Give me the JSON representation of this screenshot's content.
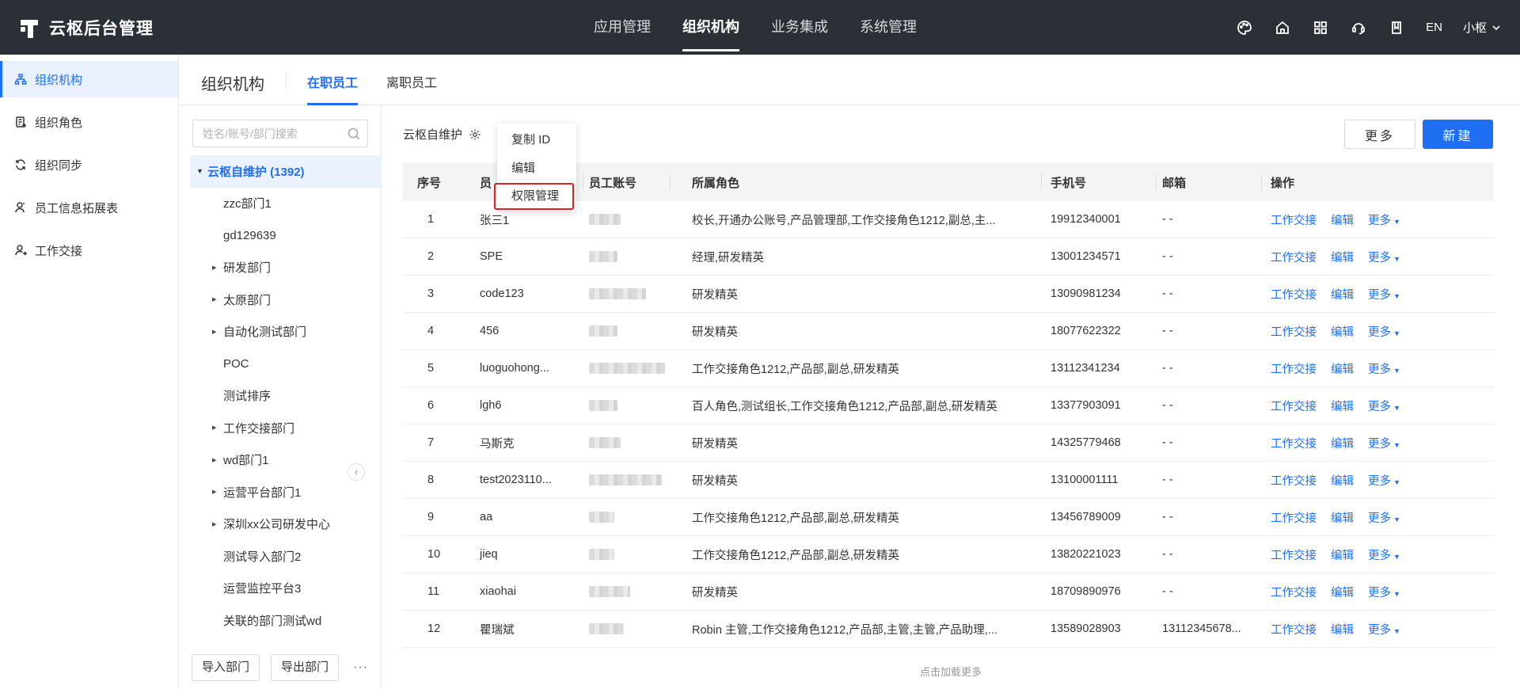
{
  "app": {
    "title": "云枢后台管理"
  },
  "topnav": [
    {
      "label": "应用管理"
    },
    {
      "label": "组织机构"
    },
    {
      "label": "业务集成"
    },
    {
      "label": "系统管理"
    }
  ],
  "topright": {
    "icons": [
      "palette-icon",
      "home-icon",
      "apps-grid-icon",
      "headset-icon",
      "book-icon"
    ],
    "language": "EN",
    "user": "小枢"
  },
  "sidebar": {
    "items": [
      {
        "label": "组织机构",
        "icon": "org-tree-icon"
      },
      {
        "label": "组织角色",
        "icon": "role-icon"
      },
      {
        "label": "组织同步",
        "icon": "sync-icon"
      },
      {
        "label": "员工信息拓展表",
        "icon": "user-icon"
      },
      {
        "label": "工作交接",
        "icon": "handover-icon"
      }
    ]
  },
  "page": {
    "title": "组织机构",
    "tabs": [
      {
        "label": "在职员工"
      },
      {
        "label": "离职员工"
      }
    ]
  },
  "dept": {
    "search_placeholder": "姓名/账号/部门搜索",
    "root": "云枢自维护 (1392)",
    "children": [
      {
        "label": "zzc部门1",
        "expandable": false
      },
      {
        "label": "gd129639",
        "expandable": false
      },
      {
        "label": "研发部门",
        "expandable": true
      },
      {
        "label": "太原部门",
        "expandable": true
      },
      {
        "label": "自动化测试部门",
        "expandable": true
      },
      {
        "label": "POC",
        "expandable": false
      },
      {
        "label": "测试排序",
        "expandable": false
      },
      {
        "label": "工作交接部门",
        "expandable": true
      },
      {
        "label": "wd部门1",
        "expandable": true
      },
      {
        "label": "运营平台部门1",
        "expandable": true
      },
      {
        "label": "深圳xx公司研发中心",
        "expandable": true
      },
      {
        "label": "测试导入部门2",
        "expandable": false
      },
      {
        "label": "运营监控平台3",
        "expandable": false
      },
      {
        "label": "关联的部门测试wd",
        "expandable": false
      }
    ],
    "footer": {
      "import": "导入部门",
      "export": "导出部门",
      "more": "···"
    }
  },
  "main": {
    "breadcrumb": "云枢自维护",
    "more_button": "更多",
    "new_button": "新建",
    "columns": [
      "序号",
      "员",
      "员工账号",
      "所属角色",
      "手机号",
      "邮箱",
      "操作"
    ],
    "rows": [
      {
        "no": "1",
        "name": "张三1",
        "roles": "校长,开通办公账号,产品管理部,工作交接角色1212,副总,主...",
        "phone": "19912340001",
        "email": "- -",
        "acct_w": 40
      },
      {
        "no": "2",
        "name": "SPE",
        "roles": "经理,研发精英",
        "phone": "13001234571",
        "email": "- -",
        "acct_w": 36
      },
      {
        "no": "3",
        "name": "code123",
        "roles": "研发精英",
        "phone": "13090981234",
        "email": "- -",
        "acct_w": 72
      },
      {
        "no": "4",
        "name": "456",
        "roles": "研发精英",
        "phone": "18077622322",
        "email": "- -",
        "acct_w": 36
      },
      {
        "no": "5",
        "name": "luoguohong...",
        "roles": "工作交接角色1212,产品部,副总,研发精英",
        "phone": "13112341234",
        "email": "- -",
        "acct_w": 96
      },
      {
        "no": "6",
        "name": "lgh6",
        "roles": "百人角色,测试组长,工作交接角色1212,产品部,副总,研发精英",
        "phone": "13377903091",
        "email": "- -",
        "acct_w": 36
      },
      {
        "no": "7",
        "name": "马斯克",
        "roles": "研发精英",
        "phone": "14325779468",
        "email": "- -",
        "acct_w": 40
      },
      {
        "no": "8",
        "name": "test2023110...",
        "roles": "研发精英",
        "phone": "13100001111",
        "email": "- -",
        "acct_w": 92
      },
      {
        "no": "9",
        "name": "aa",
        "roles": "工作交接角色1212,产品部,副总,研发精英",
        "phone": "13456789009",
        "email": "- -",
        "acct_w": 32
      },
      {
        "no": "10",
        "name": "jieq",
        "roles": "工作交接角色1212,产品部,副总,研发精英",
        "phone": "13820221023",
        "email": "- -",
        "acct_w": 32
      },
      {
        "no": "11",
        "name": "xiaohai",
        "roles": "研发精英",
        "phone": "18709890976",
        "email": "- -",
        "acct_w": 52
      },
      {
        "no": "12",
        "name": "瞿瑞斌",
        "roles": "Robin 主管,工作交接角色1212,产品部,主管,主管,产品助理,...",
        "phone": "13589028903",
        "email": "13112345678...",
        "acct_w": 44
      }
    ],
    "actions": {
      "handover": "工作交接",
      "edit": "编辑",
      "more": "更多"
    },
    "load_more": "点击加载更多"
  },
  "dropdown": {
    "items": [
      "复制 ID",
      "编辑",
      "权限管理"
    ],
    "highlight_color": "#e0201c"
  },
  "colors": {
    "accent": "#1f6ff2",
    "topbar": "#2b2f36"
  }
}
